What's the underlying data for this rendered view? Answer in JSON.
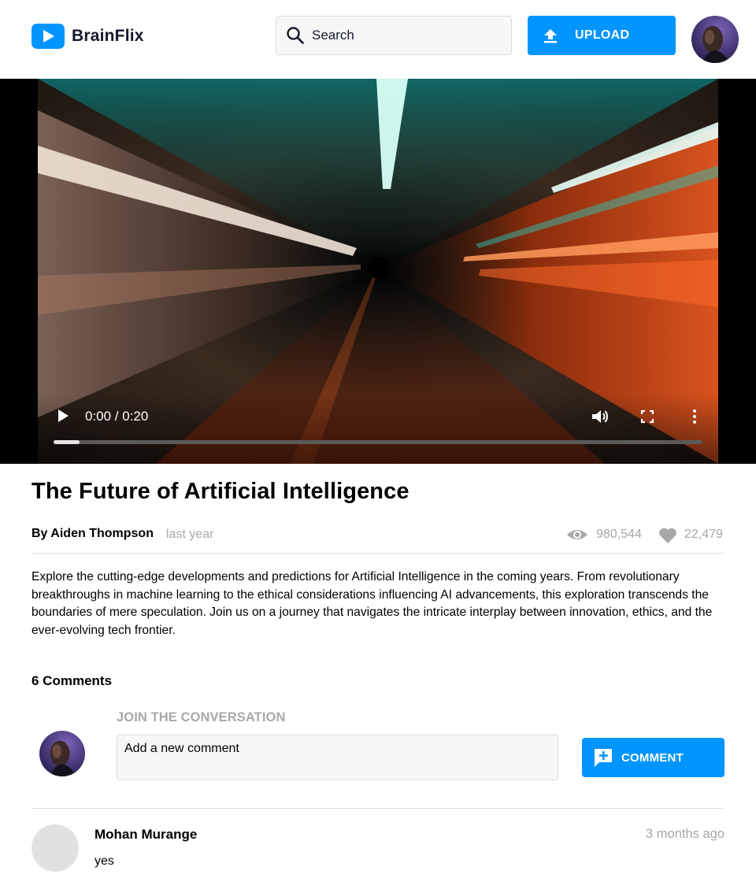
{
  "header": {
    "brand": "BrainFlix",
    "search": {
      "placeholder": "Search",
      "value": ""
    },
    "upload_label": "UPLOAD",
    "icons": {
      "logo": "play-icon",
      "search": "search-icon",
      "upload": "upload-icon",
      "avatar": "user-avatar"
    }
  },
  "video": {
    "time": "0:00 / 0:20",
    "progress": 0.04,
    "icons": [
      "play-icon",
      "volume-icon",
      "fullscreen-icon",
      "more-vert-icon"
    ]
  },
  "details": {
    "title": "The Future of Artificial Intelligence",
    "author": "By Aiden Thompson",
    "date": "last year",
    "views": "980,544",
    "likes": "22,479",
    "description": "Explore the cutting-edge developments and predictions for Artificial Intelligence in the coming years. From revolutionary breakthroughs in machine learning to the ethical considerations influencing AI advancements, this exploration transcends the boundaries of mere speculation. Join us on a journey that navigates the intricate interplay between innovation, ethics, and the ever-evolving tech frontier."
  },
  "comments": {
    "count_label": "6 Comments",
    "form": {
      "heading": "JOIN THE CONVERSATION",
      "placeholder": "Add a new comment",
      "value": "",
      "button_label": "COMMENT"
    },
    "items": [
      {
        "author": "Mohan Murange",
        "time": "3 months ago",
        "text": "yes"
      }
    ]
  },
  "colors": {
    "accent": "#0095ff",
    "muted": "#a7a7a7",
    "border": "#e1e1e1"
  }
}
